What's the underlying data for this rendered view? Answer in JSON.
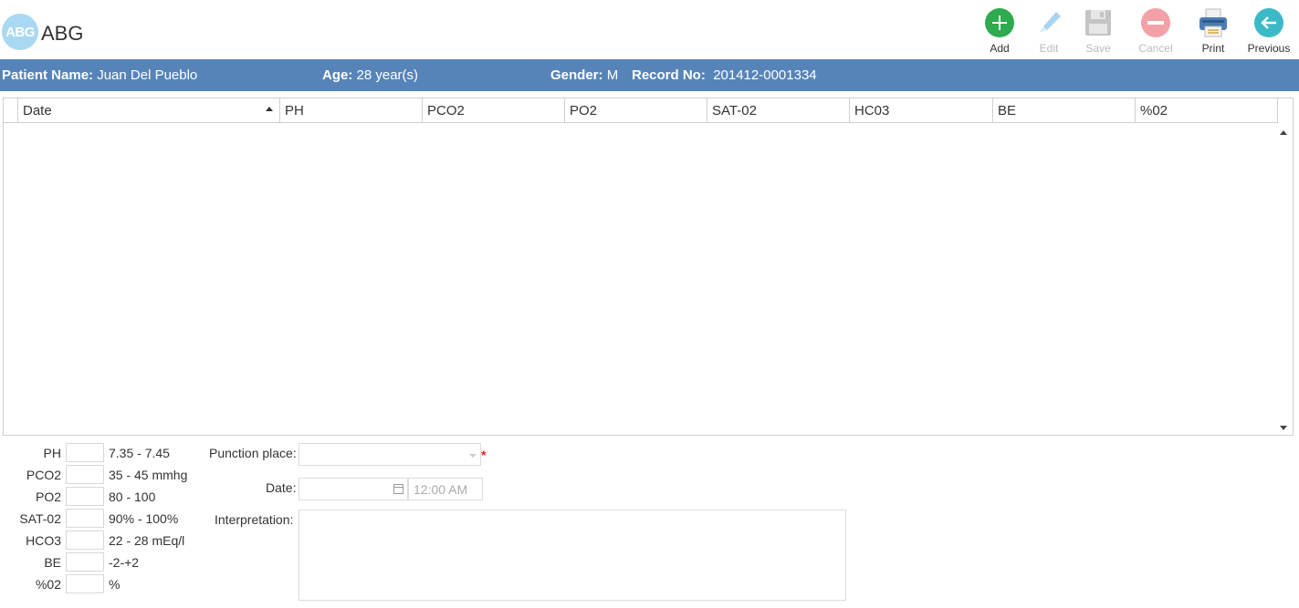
{
  "app": {
    "logo_text": "ABG",
    "title": "ABG"
  },
  "toolbar": [
    {
      "label": "Add",
      "icon": "add-icon",
      "color": "#2eaa4f",
      "enabled": true
    },
    {
      "label": "Edit",
      "icon": "edit-icon",
      "color": "#a9d3f0",
      "enabled": false
    },
    {
      "label": "Save",
      "icon": "save-icon",
      "color": "#c4c4c4",
      "enabled": false
    },
    {
      "label": "Cancel",
      "icon": "cancel-icon",
      "color": "#f2a1a8",
      "enabled": false
    },
    {
      "label": "Print",
      "icon": "print-icon",
      "color": "#4a7cb3",
      "enabled": true
    },
    {
      "label": "Previous",
      "icon": "previous-icon",
      "color": "#3cb9c7",
      "enabled": true
    }
  ],
  "patient": {
    "name_label": "Patient Name:",
    "name": "Juan Del Pueblo",
    "age_label": "Age:",
    "age": "28 year(s)",
    "gender_label": "Gender:",
    "gender": "M",
    "record_label": "Record No:",
    "record": "201412-0001334",
    "bar_color": "#5784b8"
  },
  "grid": {
    "columns": [
      "Date",
      "PH",
      "PCO2",
      "PO2",
      "SAT-02",
      "HC03",
      "BE",
      "%02"
    ],
    "rows": []
  },
  "references": [
    {
      "label": "PH",
      "value": "",
      "range": "7.35 - 7.45"
    },
    {
      "label": "PCO2",
      "value": "",
      "range": "35 - 45 mmhg"
    },
    {
      "label": "PO2",
      "value": "",
      "range": "80 - 100"
    },
    {
      "label": "SAT-02",
      "value": "",
      "range": "90% - 100%"
    },
    {
      "label": "HCO3",
      "value": "",
      "range": "22 - 28 mEq/l"
    },
    {
      "label": "BE",
      "value": "",
      "range": "-2-+2"
    },
    {
      "label": "%02",
      "value": "",
      "range": "%"
    }
  ],
  "form": {
    "punction_label": "Punction place:",
    "punction_value": "",
    "required_mark": "*",
    "date_label": "Date:",
    "date_value": "",
    "time_value": "12:00 AM",
    "interpretation_label": "Interpretation:",
    "interpretation_value": ""
  }
}
